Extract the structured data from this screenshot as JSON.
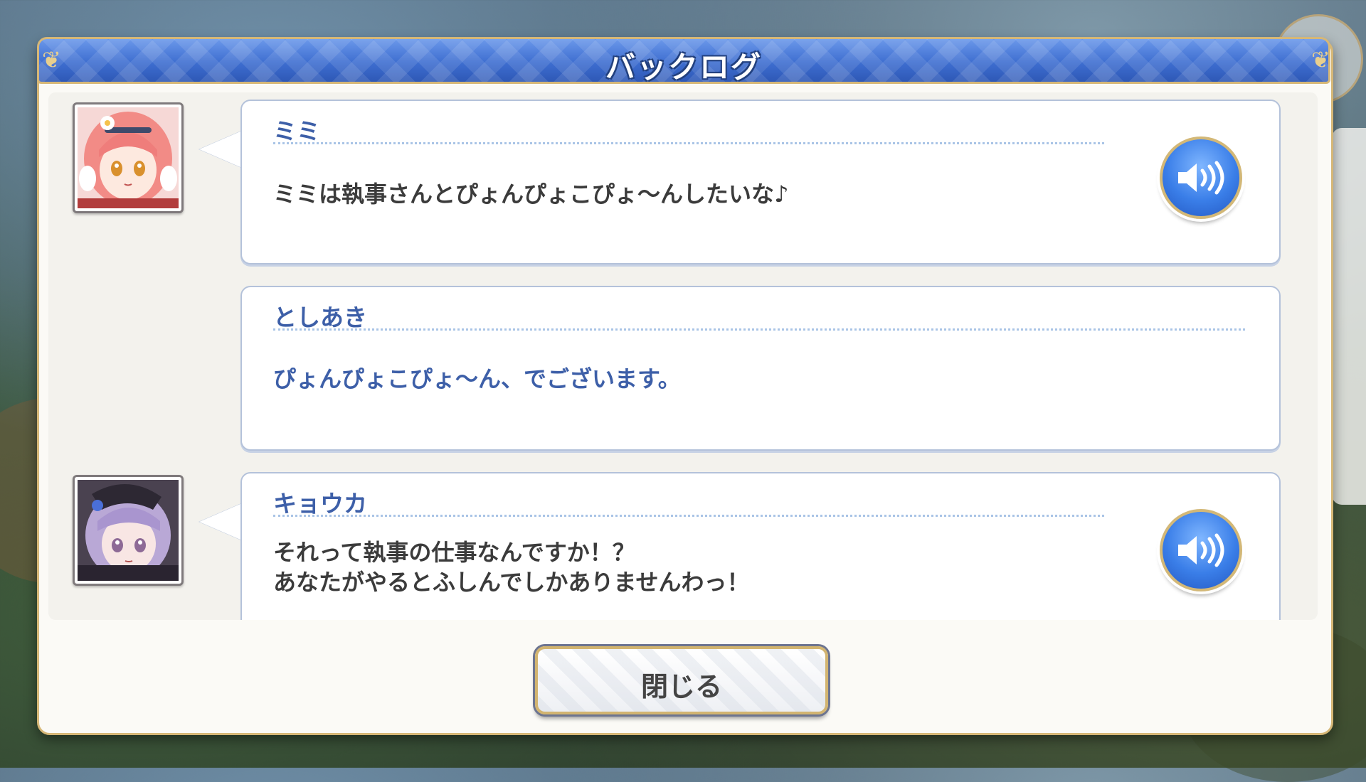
{
  "window": {
    "title": "バックログ"
  },
  "entries": [
    {
      "speaker": "ミミ",
      "lines": [
        "ミミは執事さんとぴょんぴょこぴょ〜んしたいな♪"
      ],
      "has_portrait": true,
      "has_voice": true,
      "is_player": false
    },
    {
      "speaker": "としあき",
      "lines": [
        "ぴょんぴょこぴょ〜ん、でございます。"
      ],
      "has_portrait": false,
      "has_voice": false,
      "is_player": true
    },
    {
      "speaker": "キョウカ",
      "lines": [
        "それって執事の仕事なんですか！？",
        "あなたがやるとふしんでしかありませんわっ！"
      ],
      "has_portrait": true,
      "has_voice": true,
      "is_player": false
    }
  ],
  "buttons": {
    "close_label": "閉じる"
  },
  "icons": {
    "voice": "speaker-icon"
  },
  "colors": {
    "header": "#3e6ed0",
    "gold_border": "#d6b777",
    "speaker_name": "#3d5fa8",
    "scroll_thumb": "#3a78e2"
  }
}
